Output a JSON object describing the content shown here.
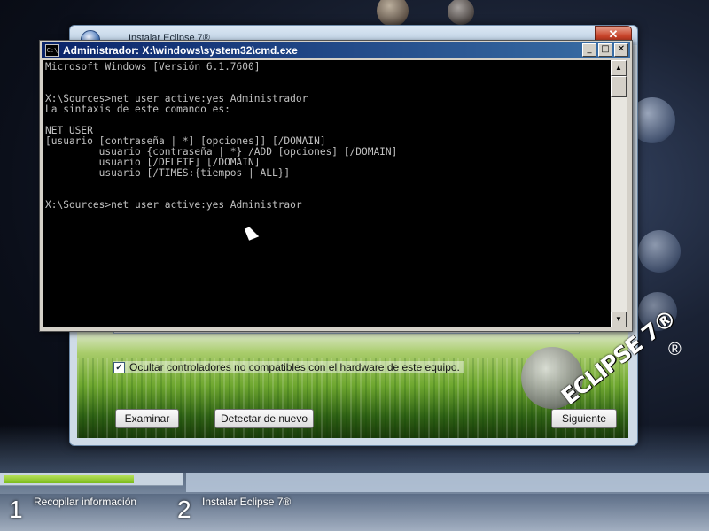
{
  "installer": {
    "title": "Instalar Eclipse 7®",
    "close_label": "✕",
    "checkbox_label": "Ocultar controladores no compatibles con el hardware de este equipo.",
    "checkbox_checked": "✓",
    "browse_label": "Examinar",
    "rescan_label": "Detectar de nuevo",
    "next_label": "Siguiente",
    "logo_text": "ECLIPSE 7®",
    "logo_reg": "®"
  },
  "cmd": {
    "title": "Administrador: X:\\windows\\system32\\cmd.exe",
    "icon_label": "C:\\",
    "minimize": "_",
    "maximize": "□",
    "close": "✕",
    "lines": [
      "Microsoft Windows [Versión 6.1.7600]",
      "",
      "",
      "X:\\Sources>net user active:yes Administrador",
      "La sintaxis de este comando es:",
      "",
      "NET USER",
      "[usuario [contraseña | *] [opciones]] [/DOMAIN]",
      "         usuario {contraseña | *} /ADD [opciones] [/DOMAIN]",
      "         usuario [/DELETE] [/DOMAIN]",
      "         usuario [/TIMES:{tiempos | ALL}]",
      "",
      "",
      "X:\\Sources>net user active:yes Administraor"
    ],
    "scroll_up": "▲",
    "scroll_down": "▼"
  },
  "steps": [
    {
      "number": "1",
      "label": "Recopilar información"
    },
    {
      "number": "2",
      "label": "Instalar Eclipse 7®"
    }
  ],
  "progress": {
    "step1_fraction": 0.74
  },
  "colors": {
    "progress_fill": "#7cbc1c",
    "cmd_bg": "#000000",
    "cmd_text": "#c0c0c0",
    "cmd_title": "#0a246a"
  }
}
